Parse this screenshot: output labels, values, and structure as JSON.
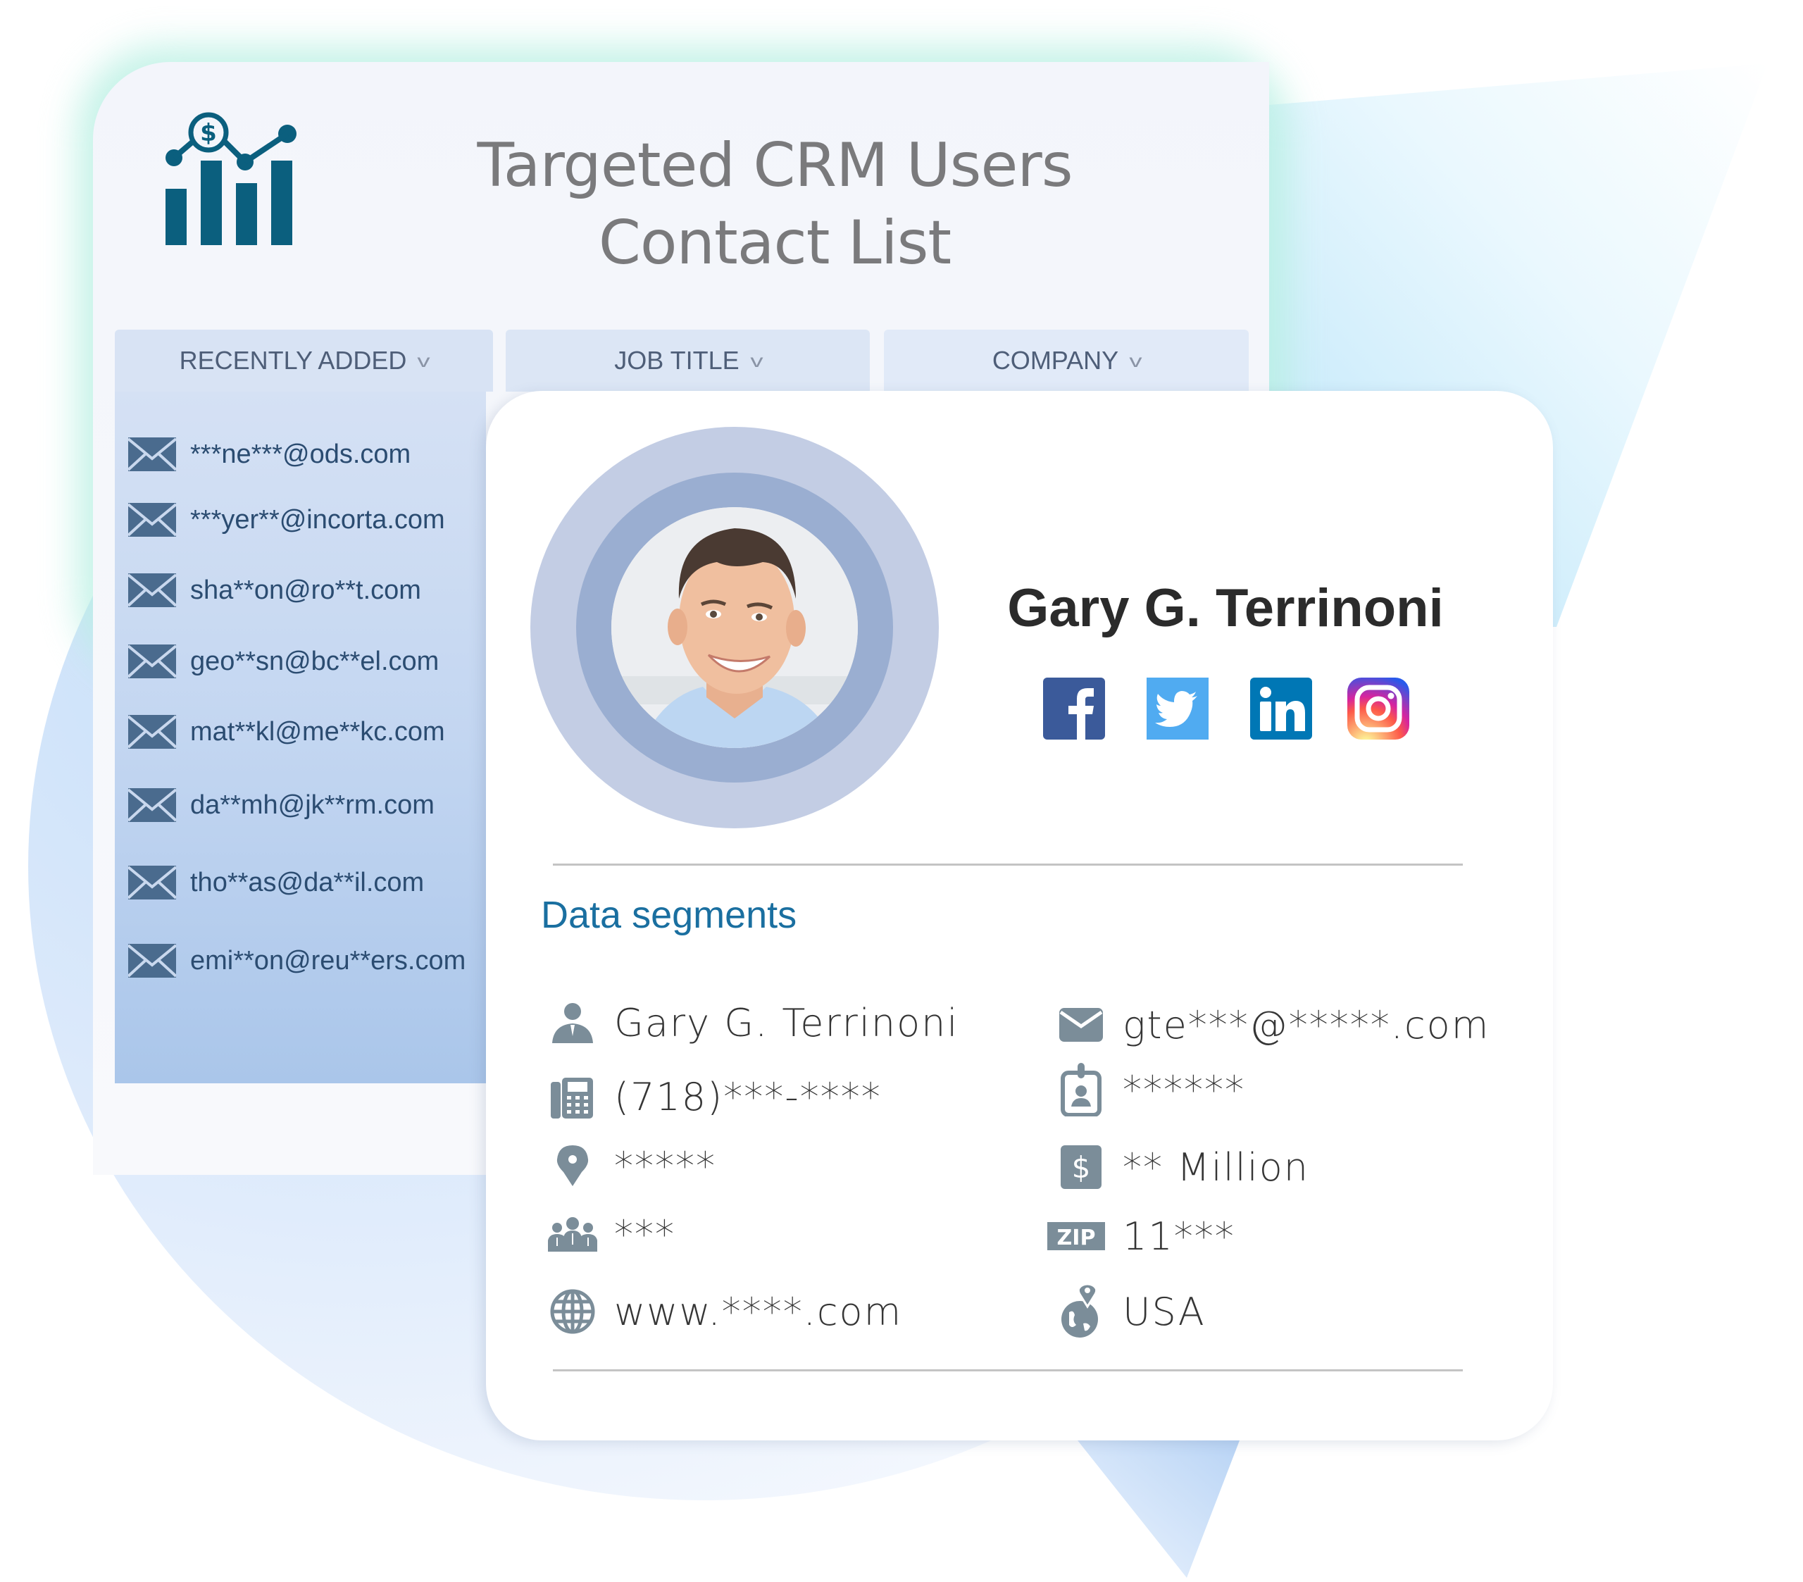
{
  "header": {
    "title_line1": "Targeted CRM Users",
    "title_line2": "Contact List",
    "logo_icon": "chart-dollar-icon"
  },
  "tabs": [
    {
      "label": "RECENTLY ADDED",
      "icon": "chevron-down-icon"
    },
    {
      "label": "JOB TITLE",
      "icon": "chevron-down-icon"
    },
    {
      "label": "COMPANY",
      "icon": "chevron-down-icon"
    }
  ],
  "chevron_glyph": "v",
  "recent_emails": [
    "***ne***@ods.com",
    "***yer**@incorta.com",
    "sha**on@ro**t.com",
    "geo**sn@bc**el.com",
    "mat**kl@me**kc.com",
    "da**mh@jk**rm.com",
    "tho**as@da**il.com",
    "emi**on@reu**ers.com"
  ],
  "profile": {
    "name": "Gary G. Terrinoni",
    "social": [
      {
        "name": "facebook",
        "color": "#3b5a9a"
      },
      {
        "name": "twitter",
        "color": "#50abf1"
      },
      {
        "name": "linkedin",
        "color": "#0077b5"
      },
      {
        "name": "instagram",
        "color": "#d6249f"
      }
    ]
  },
  "segments": {
    "title": "Data segments",
    "left": [
      {
        "icon": "person-icon",
        "value": "Gary G. Terrinoni"
      },
      {
        "icon": "phone-fax-icon",
        "value": "(718)***-****"
      },
      {
        "icon": "location-pin-icon",
        "value": "*****"
      },
      {
        "icon": "team-icon",
        "value": "***"
      },
      {
        "icon": "globe-icon",
        "value": "www.****.com"
      }
    ],
    "right": [
      {
        "icon": "envelope-icon",
        "value": "gte***@*****.com"
      },
      {
        "icon": "id-badge-icon",
        "value": "******"
      },
      {
        "icon": "dollar-icon",
        "value": "** Million"
      },
      {
        "icon": "zip-icon",
        "value": "11***",
        "icon_text": "ZIP"
      },
      {
        "icon": "globe-pin-icon",
        "value": "USA"
      }
    ]
  },
  "colors": {
    "accent": "#1a6fa0",
    "logo": "#0b5f7e",
    "icon_gray": "#7b8d99",
    "email_text": "#2b4c71",
    "tab_text": "#4e5e78"
  }
}
